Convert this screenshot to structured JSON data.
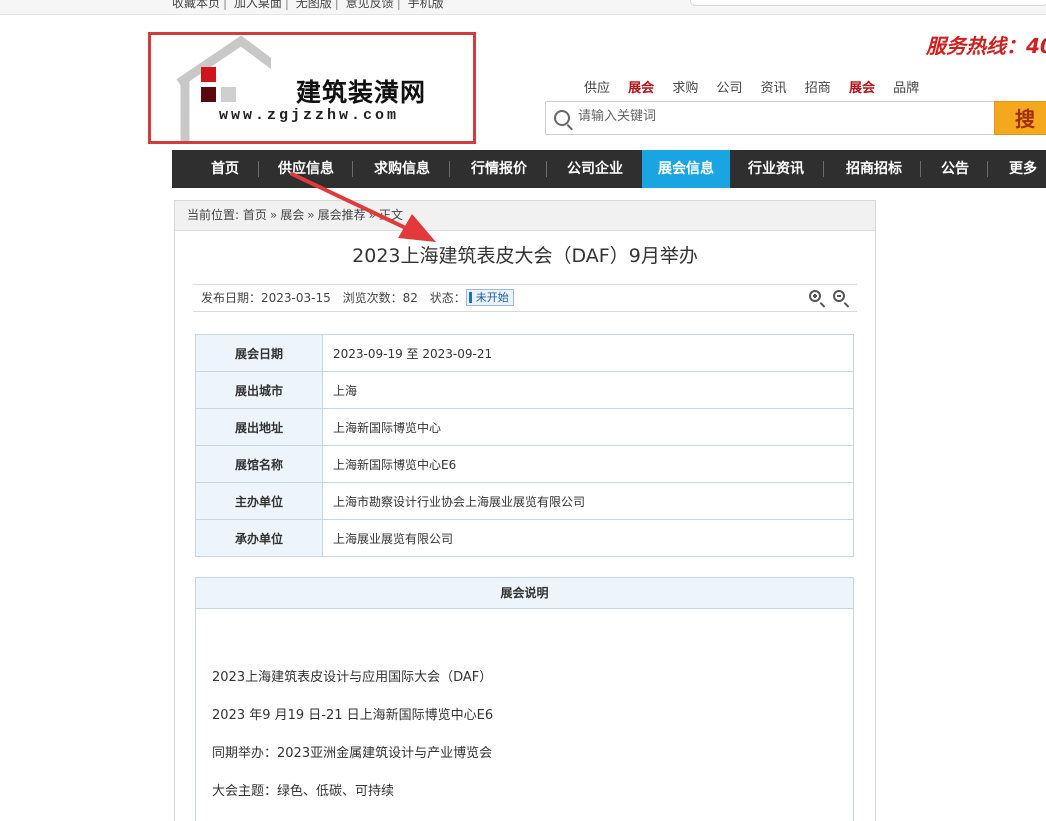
{
  "top": {
    "links": [
      "收藏本页",
      "加入桌面",
      "无图版",
      "意见反馈",
      "手机版"
    ]
  },
  "logo": {
    "name": "建筑装潢网",
    "url": "www.zgjzzhw.com"
  },
  "header": {
    "hotline": "服务热线：40"
  },
  "category_tabs": [
    {
      "label": "供应"
    },
    {
      "label": "展会"
    },
    {
      "label": "求购"
    },
    {
      "label": "公司"
    },
    {
      "label": "资讯"
    },
    {
      "label": "招商"
    },
    {
      "label": "展会"
    },
    {
      "label": "品牌"
    }
  ],
  "search": {
    "placeholder": "请输入关键词",
    "button_label": "搜"
  },
  "nav": [
    {
      "label": "首页"
    },
    {
      "label": "供应信息"
    },
    {
      "label": "求购信息"
    },
    {
      "label": "行情报价"
    },
    {
      "label": "公司企业"
    },
    {
      "label": "展会信息"
    },
    {
      "label": "行业资讯"
    },
    {
      "label": "招商招标"
    },
    {
      "label": "公告"
    },
    {
      "label": "更多"
    }
  ],
  "breadcrumb": {
    "prefix": "当前位置:",
    "items": [
      "首页",
      "展会",
      "展会推荐",
      "正文"
    ]
  },
  "article": {
    "title": "2023上海建筑表皮大会（DAF）9月举办",
    "publish_label": "发布日期：",
    "publish_date": "2023-03-15",
    "views_label": "浏览次数：",
    "views": "82",
    "status_label": "状态：",
    "status": "未开始"
  },
  "info_table": [
    {
      "key": "展会日期",
      "value": "2023-09-19 至 2023-09-21"
    },
    {
      "key": "展出城市",
      "value": "上海"
    },
    {
      "key": "展出地址",
      "value": "上海新国际博览中心"
    },
    {
      "key": "展馆名称",
      "value": "上海新国际博览中心E6"
    },
    {
      "key": "主办单位",
      "value": "上海市勘察设计行业协会上海展业展览有限公司"
    },
    {
      "key": "承办单位",
      "value": "上海展业展览有限公司"
    }
  ],
  "description": {
    "header": "展会说明",
    "lines": [
      "2023上海建筑表皮设计与应用国际大会（DAF）",
      "2023 年9 月19 日-21 日上海新国际博览中心E6",
      "同期举办：2023亚洲金属建筑设计与产业博览会",
      "大会主题：绿色、低碳、可持续"
    ]
  },
  "colors": {
    "nav_bg": "#2f2f2f",
    "nav_active": "#1aa5e2",
    "accent_red": "#d23c3c",
    "search_button": "#f4a81d"
  }
}
